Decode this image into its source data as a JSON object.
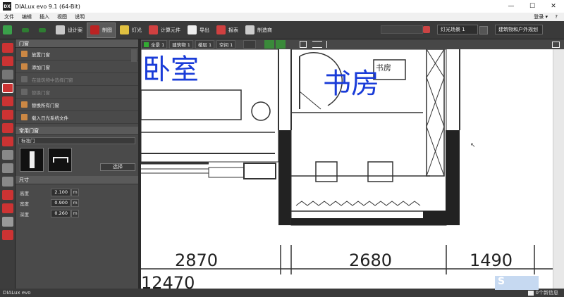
{
  "app": {
    "title": "DIALux evo 9.1  (64-Bit)",
    "icon_text": "DX"
  },
  "window_controls": {
    "minimize": "—",
    "maximize": "☐",
    "close": "✕"
  },
  "menu": {
    "items": [
      "文件",
      "编辑",
      "插入",
      "视图",
      "说明"
    ],
    "login": "登录 ▾",
    "help": "?"
  },
  "toolbar": {
    "buttons": [
      {
        "label": "设计案",
        "icon": "design-icon"
      },
      {
        "label": "制图",
        "icon": "drawing-icon",
        "active": true
      },
      {
        "label": "灯光",
        "icon": "light-icon"
      },
      {
        "label": "计算元件",
        "icon": "calc-icon"
      },
      {
        "label": "导出",
        "icon": "export-icon"
      },
      {
        "label": "报表",
        "icon": "report-icon"
      },
      {
        "label": "制造商",
        "icon": "manufacturer-icon"
      }
    ],
    "scene_select": "灯光场景 1",
    "view_select": "建筑物和户外规划"
  },
  "subtoolbar": {
    "chips": [
      "全景 1",
      "建筑物 1",
      "楼层 1",
      "空间 1"
    ]
  },
  "panel": {
    "section_doors": "门窗",
    "actions": [
      {
        "label": "放置门窗",
        "disabled": false
      },
      {
        "label": "添加门窗",
        "disabled": false
      },
      {
        "label": "在建筑物中选择门窗",
        "disabled": true
      },
      {
        "label": "替换门窗",
        "disabled": true
      },
      {
        "label": "替换所有门窗",
        "disabled": false
      },
      {
        "label": "载入日光系统文件",
        "disabled": false
      }
    ],
    "section_common": "常用门窗",
    "door_type": "标准门",
    "select_button": "选择",
    "section_size": "尺寸",
    "dimensions": [
      {
        "label": "高度",
        "value": "2.100",
        "unit": "m"
      },
      {
        "label": "宽度",
        "value": "0.900",
        "unit": "m"
      },
      {
        "label": "深度",
        "value": "0.260",
        "unit": "m"
      }
    ]
  },
  "drawing": {
    "room1": "卧室",
    "room2": "书房",
    "room2_small": "书房",
    "dims": [
      "2870",
      "2680",
      "1490"
    ],
    "total": "12470"
  },
  "status": {
    "app": "DIALux evo",
    "messages": "0个新信息",
    "watermark": "S"
  },
  "colors": {
    "accent": "#1a3cd8",
    "panel_bg": "#4a4a4a",
    "toolbar_bg": "#3a3a3a"
  }
}
